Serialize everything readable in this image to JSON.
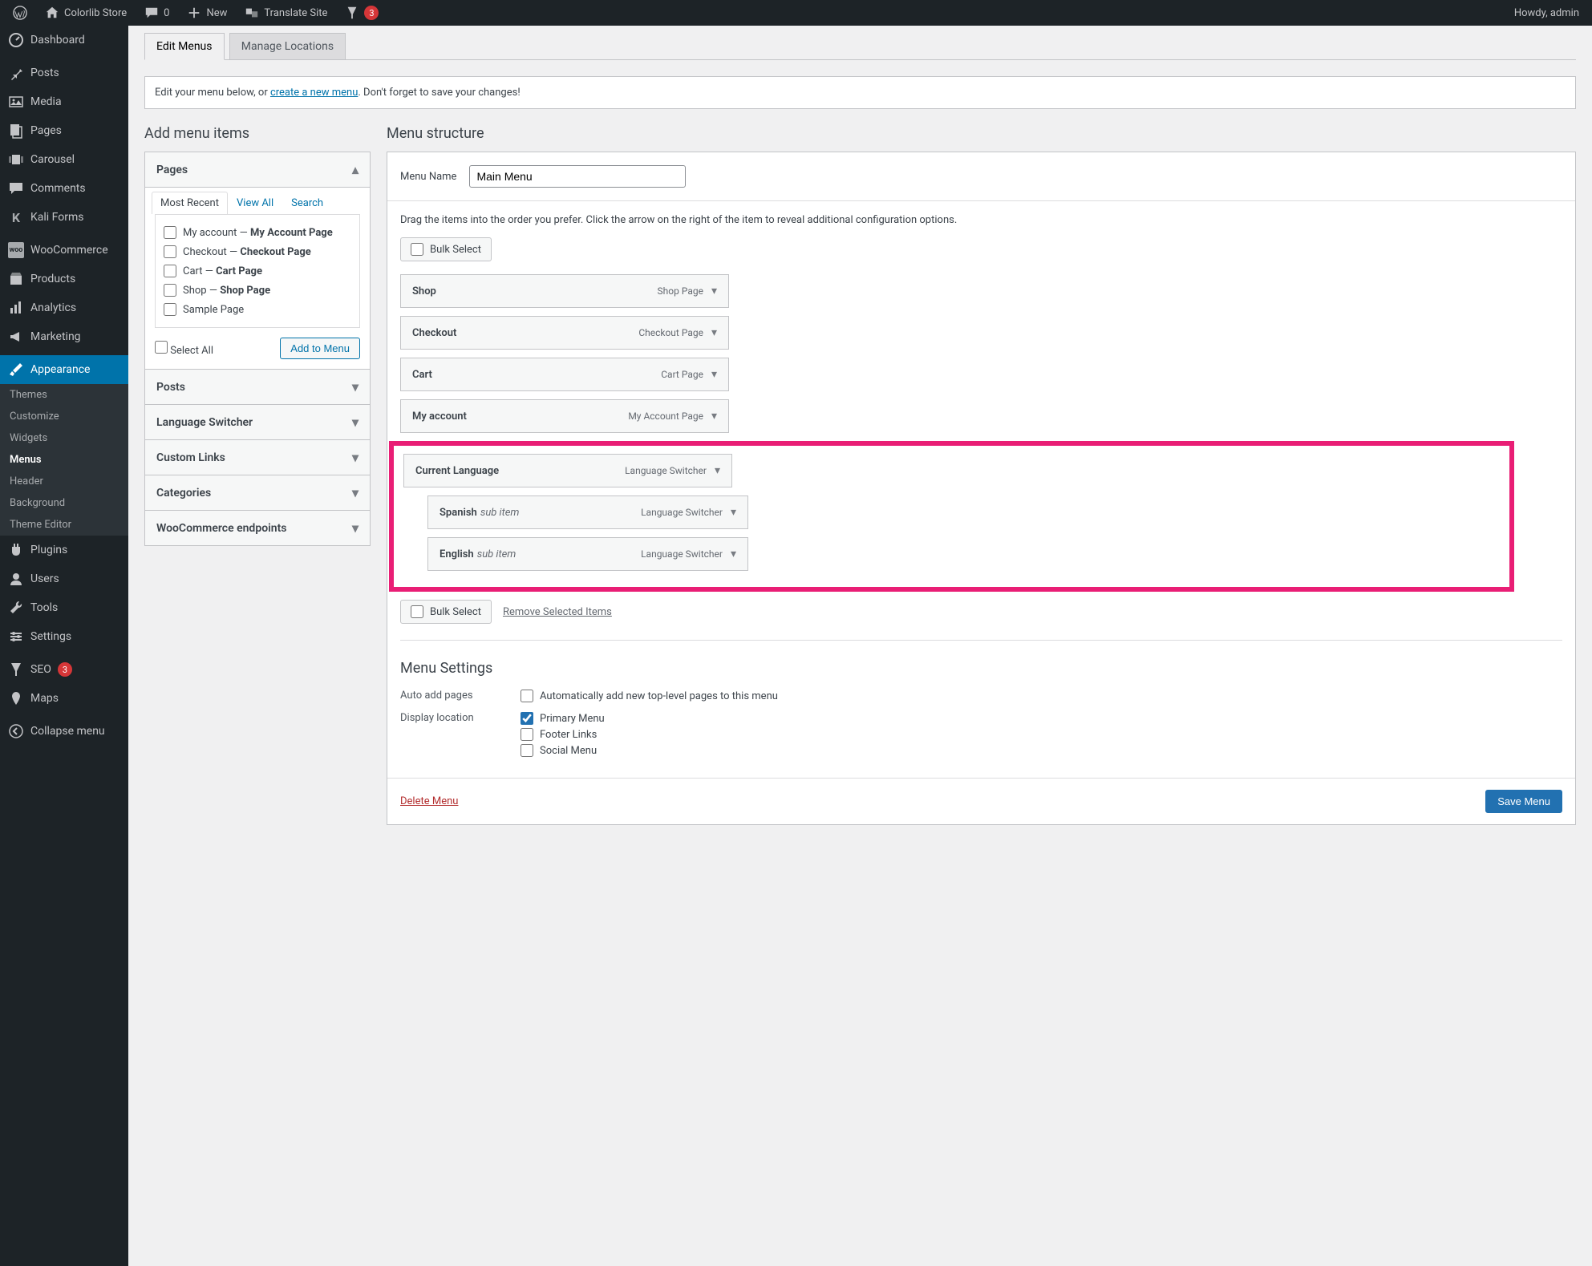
{
  "adminbar": {
    "site_name": "Colorlib Store",
    "comments": "0",
    "new_label": "New",
    "translate_label": "Translate Site",
    "yoast_count": "3",
    "howdy": "Howdy, admin"
  },
  "sidenav": {
    "items": [
      {
        "label": "Dashboard"
      },
      {
        "label": "Posts"
      },
      {
        "label": "Media"
      },
      {
        "label": "Pages"
      },
      {
        "label": "Carousel"
      },
      {
        "label": "Comments"
      },
      {
        "label": "Kali Forms"
      },
      {
        "label": "WooCommerce"
      },
      {
        "label": "Products"
      },
      {
        "label": "Analytics"
      },
      {
        "label": "Marketing"
      },
      {
        "label": "Appearance"
      },
      {
        "label": "Plugins"
      },
      {
        "label": "Users"
      },
      {
        "label": "Tools"
      },
      {
        "label": "Settings"
      },
      {
        "label": "SEO"
      },
      {
        "label": "Maps"
      },
      {
        "label": "Collapse menu"
      }
    ],
    "seo_badge": "3",
    "appearance_sub": [
      "Themes",
      "Customize",
      "Widgets",
      "Menus",
      "Header",
      "Background",
      "Theme Editor"
    ]
  },
  "tabs": {
    "edit": "Edit Menus",
    "manage": "Manage Locations"
  },
  "notice": {
    "pre": "Edit your menu below, or ",
    "link": "create a new menu",
    "post": ". Don't forget to save your changes!"
  },
  "sections": {
    "add": "Add menu items",
    "structure": "Menu structure"
  },
  "accordion": {
    "pages": {
      "title": "Pages",
      "tabs": [
        "Most Recent",
        "View All",
        "Search"
      ],
      "items": [
        {
          "pre": "My account — ",
          "strong": "My Account Page"
        },
        {
          "pre": "Checkout — ",
          "strong": "Checkout Page"
        },
        {
          "pre": "Cart — ",
          "strong": "Cart Page"
        },
        {
          "pre": "Shop — ",
          "strong": "Shop Page"
        },
        {
          "pre": "Sample Page",
          "strong": ""
        }
      ],
      "select_all": "Select All",
      "add_btn": "Add to Menu"
    },
    "others": [
      "Posts",
      "Language Switcher",
      "Custom Links",
      "Categories",
      "WooCommerce endpoints"
    ]
  },
  "menu": {
    "name_label": "Menu Name",
    "name_value": "Main Menu",
    "instructions": "Drag the items into the order you prefer. Click the arrow on the right of the item to reveal additional configuration options.",
    "bulk_select": "Bulk Select",
    "remove_selected": "Remove Selected Items",
    "items": [
      {
        "title": "Shop",
        "type": "Shop Page"
      },
      {
        "title": "Checkout",
        "type": "Checkout Page"
      },
      {
        "title": "Cart",
        "type": "Cart Page"
      },
      {
        "title": "My account",
        "type": "My Account Page"
      }
    ],
    "highlight": {
      "parent": {
        "title": "Current Language",
        "type": "Language Switcher"
      },
      "children": [
        {
          "title": "Spanish",
          "sub": "sub item",
          "type": "Language Switcher"
        },
        {
          "title": "English",
          "sub": "sub item",
          "type": "Language Switcher"
        }
      ]
    }
  },
  "settings": {
    "heading": "Menu Settings",
    "auto_label": "Auto add pages",
    "auto_cb": "Automatically add new top-level pages to this menu",
    "display_label": "Display location",
    "locations": [
      "Primary Menu",
      "Footer Links",
      "Social Menu"
    ]
  },
  "footer": {
    "delete": "Delete Menu",
    "save": "Save Menu"
  }
}
